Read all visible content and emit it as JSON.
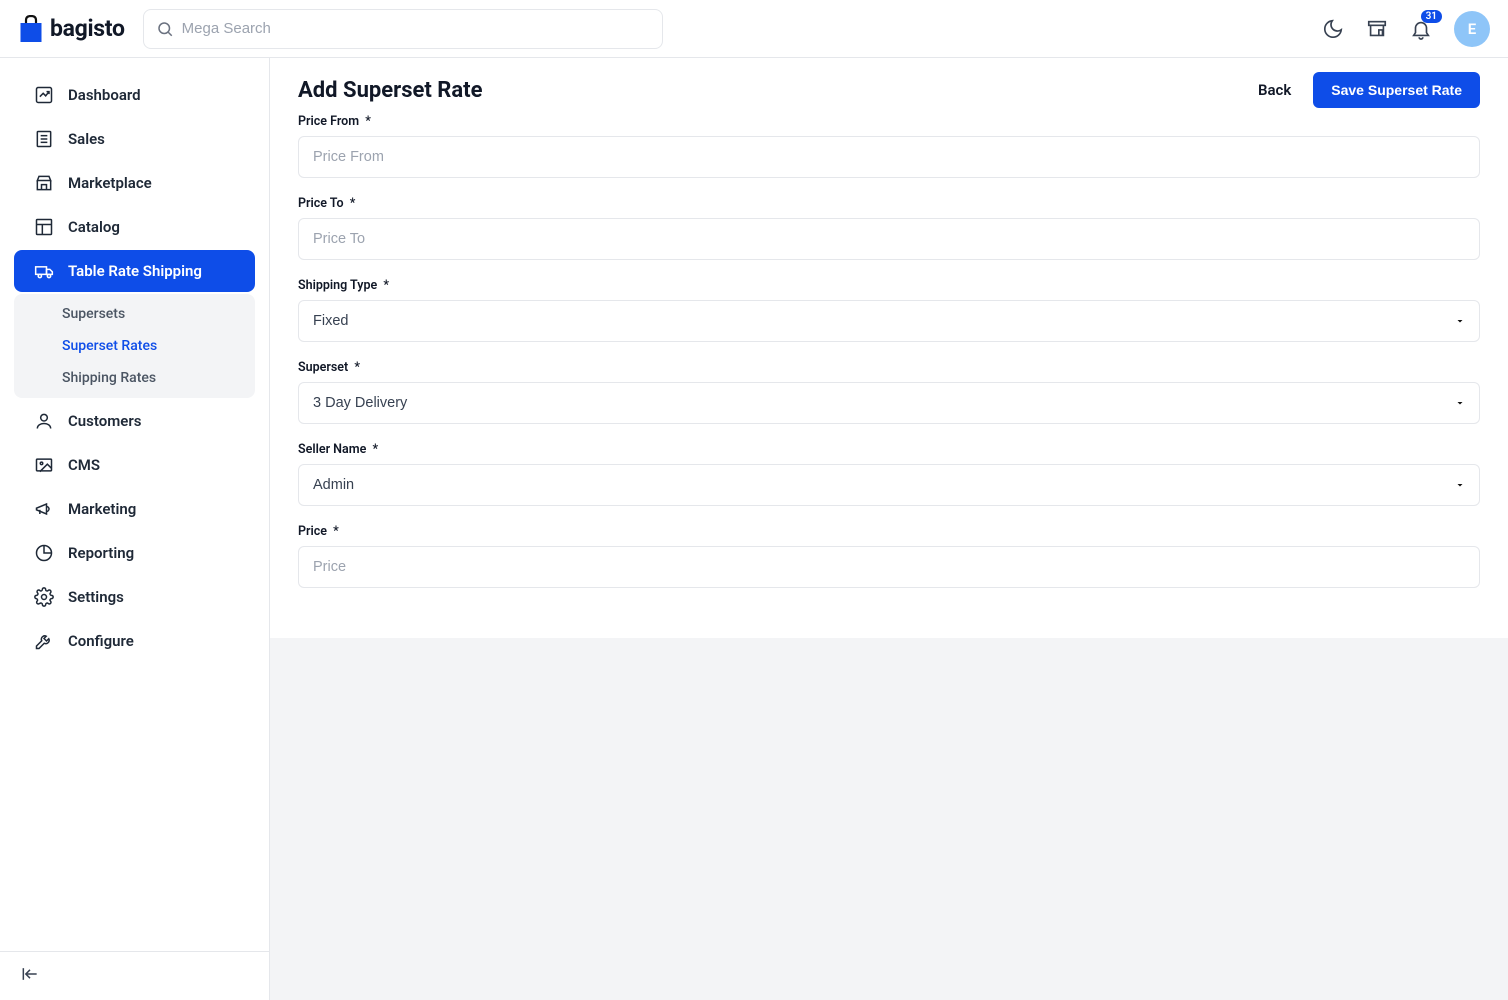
{
  "brand": "bagisto",
  "search": {
    "placeholder": "Mega Search"
  },
  "notifications": {
    "count": "31"
  },
  "avatar": {
    "initial": "E"
  },
  "sidebar": {
    "items": [
      {
        "label": "Dashboard"
      },
      {
        "label": "Sales"
      },
      {
        "label": "Marketplace"
      },
      {
        "label": "Catalog"
      },
      {
        "label": "Table Rate Shipping"
      },
      {
        "label": "Customers"
      },
      {
        "label": "CMS"
      },
      {
        "label": "Marketing"
      },
      {
        "label": "Reporting"
      },
      {
        "label": "Settings"
      },
      {
        "label": "Configure"
      }
    ],
    "sub": [
      {
        "label": "Supersets"
      },
      {
        "label": "Superset Rates"
      },
      {
        "label": "Shipping Rates"
      }
    ]
  },
  "page": {
    "title": "Add Superset Rate",
    "back": "Back",
    "save": "Save Superset Rate"
  },
  "form": {
    "price_from": {
      "label": "Price From",
      "placeholder": "Price From"
    },
    "price_to": {
      "label": "Price To",
      "placeholder": "Price To"
    },
    "shipping_type": {
      "label": "Shipping Type",
      "value": "Fixed"
    },
    "superset": {
      "label": "Superset",
      "value": "3 Day Delivery"
    },
    "seller_name": {
      "label": "Seller Name",
      "value": "Admin"
    },
    "price": {
      "label": "Price",
      "placeholder": "Price"
    },
    "required_mark": "*"
  }
}
